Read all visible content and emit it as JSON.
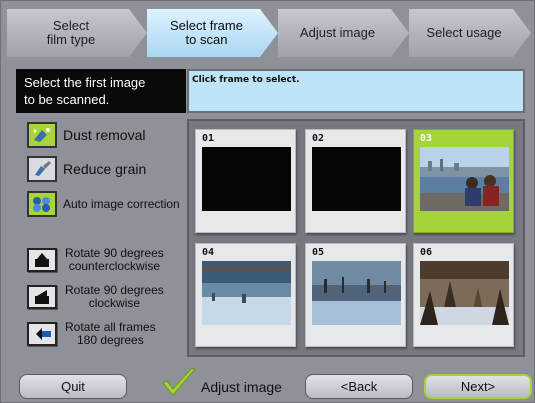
{
  "steps": [
    {
      "label": "Select\nfilm type",
      "active": false
    },
    {
      "label": "Select frame\nto scan",
      "active": true
    },
    {
      "label": "Adjust image",
      "active": false
    },
    {
      "label": "Select usage",
      "active": false
    }
  ],
  "instruction": "Select the first image\n to be scanned.",
  "hint": "Click frame to select.",
  "options": {
    "dust_removal": "Dust removal",
    "reduce_grain": "Reduce grain",
    "auto_correction": "Auto image correction"
  },
  "rotate": {
    "ccw": "Rotate 90 degrees\ncounterclockwise",
    "cw": "Rotate 90 degrees\nclockwise",
    "all": "Rotate all frames\n180 degrees"
  },
  "frames": [
    {
      "num": "01",
      "selected": false
    },
    {
      "num": "02",
      "selected": false
    },
    {
      "num": "03",
      "selected": true
    },
    {
      "num": "04",
      "selected": false
    },
    {
      "num": "05",
      "selected": false
    },
    {
      "num": "06",
      "selected": false
    }
  ],
  "footer": {
    "quit": "Quit",
    "adjust_image": "Adjust image",
    "back": "<Back",
    "next": "Next>"
  },
  "colors": {
    "accent_green": "#a6d33a",
    "active_step": "#bde3f7"
  }
}
